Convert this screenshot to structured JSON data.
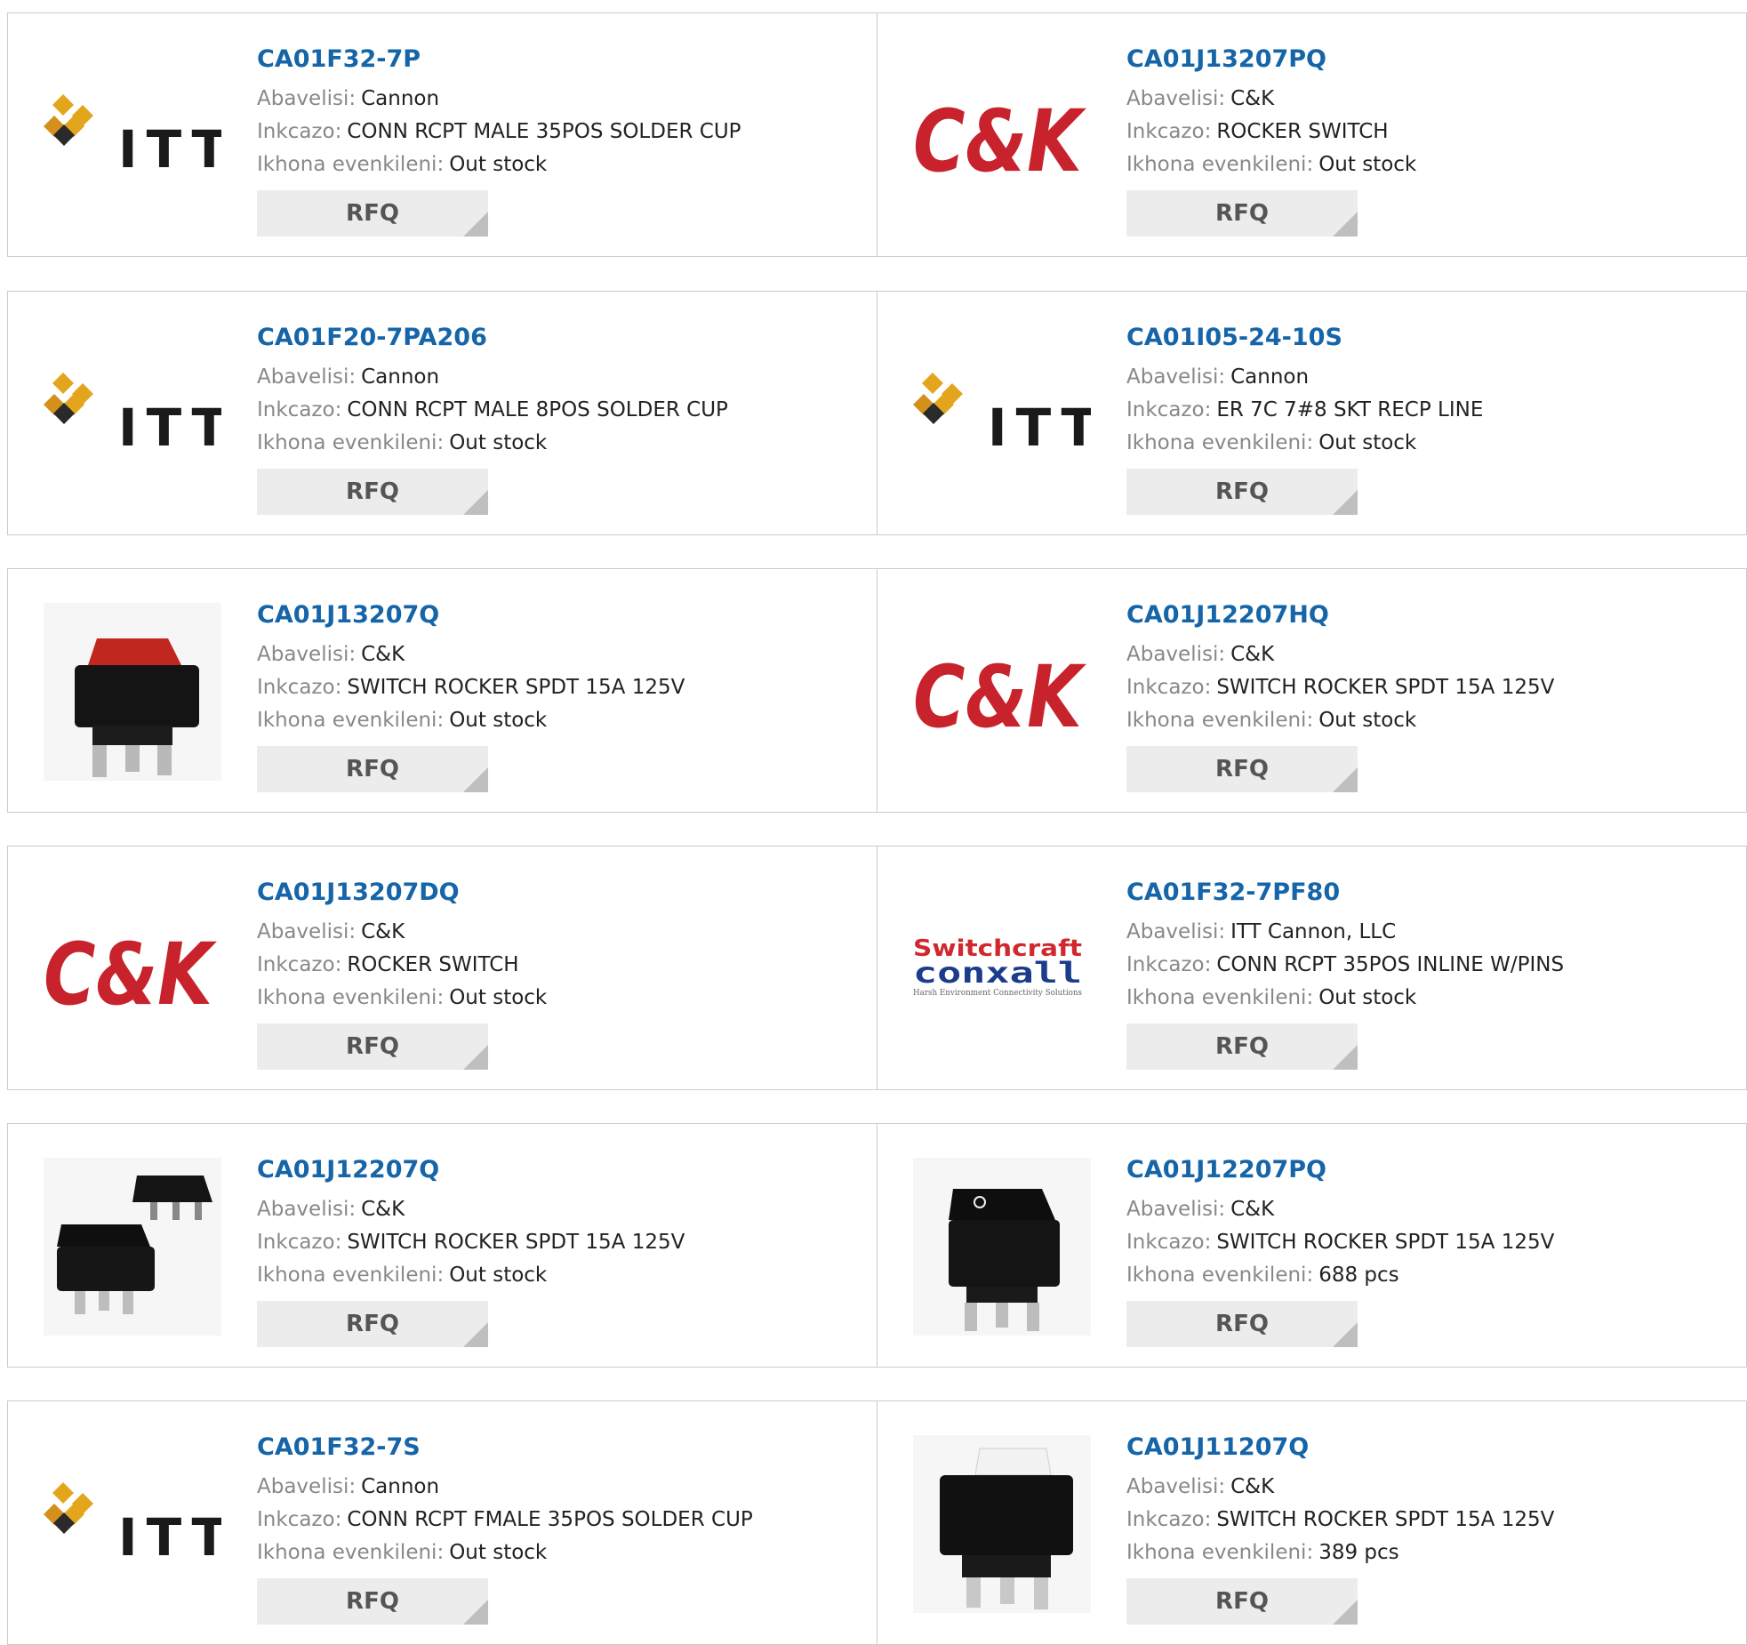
{
  "labels": {
    "manufacturer": "Abavelisi:",
    "description": "Inkcazo:",
    "stock": "Ikhona evenkileni:",
    "rfq": "RFQ"
  },
  "logo_text": {
    "itt": "ITT",
    "ck": "C&K",
    "switchcraft": "Switchcraft",
    "conxall": "conxall",
    "conxall_tagline": "Harsh Environment Connectivity Solutions"
  },
  "products": [
    {
      "part": "CA01F32-7P",
      "manufacturer": "Cannon",
      "description": "CONN RCPT MALE 35POS SOLDER CUP",
      "stock": "Out stock",
      "image": "itt-logo"
    },
    {
      "part": "CA01J13207PQ",
      "manufacturer": "C&K",
      "description": "ROCKER SWITCH",
      "stock": "Out stock",
      "image": "ck-logo"
    },
    {
      "part": "CA01F20-7PA206",
      "manufacturer": "Cannon",
      "description": "CONN RCPT MALE 8POS SOLDER CUP",
      "stock": "Out stock",
      "image": "itt-logo"
    },
    {
      "part": "CA01I05-24-10S",
      "manufacturer": "Cannon",
      "description": "ER 7C 7#8 SKT RECP LINE",
      "stock": "Out stock",
      "image": "itt-logo"
    },
    {
      "part": "CA01J13207Q",
      "manufacturer": "C&K",
      "description": "SWITCH ROCKER SPDT 15A 125V",
      "stock": "Out stock",
      "image": "switch-red"
    },
    {
      "part": "CA01J12207HQ",
      "manufacturer": "C&K",
      "description": "SWITCH ROCKER SPDT 15A 125V",
      "stock": "Out stock",
      "image": "ck-logo"
    },
    {
      "part": "CA01J13207DQ",
      "manufacturer": "C&K",
      "description": "ROCKER SWITCH",
      "stock": "Out stock",
      "image": "ck-logo"
    },
    {
      "part": "CA01F32-7PF80",
      "manufacturer": "ITT Cannon, LLC",
      "description": "CONN RCPT 35POS INLINE W/PINS",
      "stock": "Out stock",
      "image": "switchcraft-logo"
    },
    {
      "part": "CA01J12207Q",
      "manufacturer": "C&K",
      "description": "SWITCH ROCKER SPDT 15A 125V",
      "stock": "Out stock",
      "image": "switch-black-pair"
    },
    {
      "part": "CA01J12207PQ",
      "manufacturer": "C&K",
      "description": "SWITCH ROCKER SPDT 15A 125V",
      "stock": "688 pcs",
      "image": "switch-black"
    },
    {
      "part": "CA01F32-7S",
      "manufacturer": "Cannon",
      "description": "CONN RCPT FMALE 35POS SOLDER CUP",
      "stock": "Out stock",
      "image": "itt-logo"
    },
    {
      "part": "CA01J11207Q",
      "manufacturer": "C&K",
      "description": "SWITCH ROCKER SPDT 15A 125V",
      "stock": "389 pcs",
      "image": "switch-white"
    }
  ]
}
